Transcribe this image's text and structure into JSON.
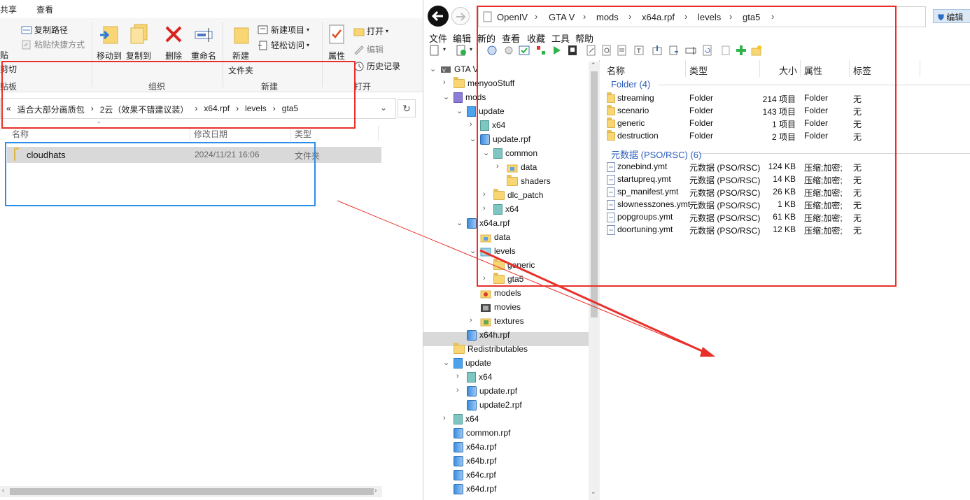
{
  "explorer": {
    "tabs": [
      "共享",
      "查看"
    ],
    "ribbon": {
      "copy_path": "复制路径",
      "paste_shortcut": "粘贴快捷方式",
      "move_to": "移动到",
      "copy_to": "复制到",
      "delete": "删除",
      "rename": "重命名",
      "new_item": "新建项目",
      "easy_access": "轻松访问",
      "new_folder_line1": "新建",
      "new_folder_line2": "文件夹",
      "open": "打开",
      "edit": "编辑",
      "history": "历史记录",
      "properties": "属性",
      "cut": "剪切",
      "paste_partial": "贴",
      "group_clipboard": "贴板",
      "group_organize": "组织",
      "group_new": "新建",
      "group_open": "打开"
    },
    "address": {
      "prefix": "«",
      "crumbs": [
        "适合大部分画质包",
        "2云（效果不错建议装）",
        "x64.rpf",
        "levels",
        "gta5"
      ]
    },
    "columns": [
      "名称",
      "修改日期",
      "类型"
    ],
    "files": [
      {
        "name": "cloudhats",
        "date": "2024/11/21 16:06",
        "type": "文件夹"
      }
    ]
  },
  "openiv": {
    "breadcrumb": [
      "OpenIV",
      "GTA V",
      "mods",
      "x64a.rpf",
      "levels",
      "gta5"
    ],
    "edit_mode": "编辑",
    "menu": [
      "文件",
      "编辑",
      "新的",
      "查看",
      "收藏",
      "工具",
      "帮助"
    ],
    "tree": [
      {
        "label": "GTA V",
        "depth": 0,
        "chev": "v",
        "icon": "gta"
      },
      {
        "label": "menyooStuff",
        "depth": 1,
        "chev": ">",
        "icon": "folder"
      },
      {
        "label": "mods",
        "depth": 1,
        "chev": "v",
        "icon": "purple"
      },
      {
        "label": "update",
        "depth": 2,
        "chev": "v",
        "icon": "blue"
      },
      {
        "label": "x64",
        "depth": 3,
        "chev": ">",
        "icon": "teal"
      },
      {
        "label": "update.rpf",
        "depth": 3,
        "chev": "v",
        "icon": "rpf"
      },
      {
        "label": "common",
        "depth": 4,
        "chev": "v",
        "icon": "teal"
      },
      {
        "label": "data",
        "depth": 5,
        "chev": ">",
        "icon": "folderdata"
      },
      {
        "label": "shaders",
        "depth": 5,
        "chev": "",
        "icon": "folder"
      },
      {
        "label": "dlc_patch",
        "depth": 4,
        "chev": ">",
        "icon": "folder"
      },
      {
        "label": "x64",
        "depth": 4,
        "chev": ">",
        "icon": "teal"
      },
      {
        "label": "x64a.rpf",
        "depth": 2,
        "chev": "v",
        "icon": "rpf"
      },
      {
        "label": "data",
        "depth": 3,
        "chev": "",
        "icon": "folderdata"
      },
      {
        "label": "levels",
        "depth": 3,
        "chev": "v",
        "icon": "levels"
      },
      {
        "label": "generic",
        "depth": 4,
        "chev": "",
        "icon": "folder"
      },
      {
        "label": "gta5",
        "depth": 4,
        "chev": ">",
        "icon": "folder"
      },
      {
        "label": "models",
        "depth": 3,
        "chev": "",
        "icon": "models"
      },
      {
        "label": "movies",
        "depth": 3,
        "chev": "",
        "icon": "movies"
      },
      {
        "label": "textures",
        "depth": 3,
        "chev": ">",
        "icon": "textures"
      },
      {
        "label": "x64h.rpf",
        "depth": 2,
        "chev": "",
        "icon": "rpf"
      },
      {
        "label": "Redistributables",
        "depth": 1,
        "chev": "",
        "icon": "folder"
      },
      {
        "label": "update",
        "depth": 1,
        "chev": "v",
        "icon": "blue"
      },
      {
        "label": "x64",
        "depth": 2,
        "chev": ">",
        "icon": "teal"
      },
      {
        "label": "update.rpf",
        "depth": 2,
        "chev": ">",
        "icon": "rpf"
      },
      {
        "label": "update2.rpf",
        "depth": 2,
        "chev": "",
        "icon": "rpf"
      },
      {
        "label": "x64",
        "depth": 1,
        "chev": ">",
        "icon": "teal"
      },
      {
        "label": "common.rpf",
        "depth": 1,
        "chev": "",
        "icon": "rpf"
      },
      {
        "label": "x64a.rpf",
        "depth": 1,
        "chev": "",
        "icon": "rpf"
      },
      {
        "label": "x64b.rpf",
        "depth": 1,
        "chev": "",
        "icon": "rpf"
      },
      {
        "label": "x64c.rpf",
        "depth": 1,
        "chev": "",
        "icon": "rpf"
      },
      {
        "label": "x64d.rpf",
        "depth": 1,
        "chev": "",
        "icon": "rpf"
      }
    ],
    "columns": [
      "名称",
      "类型",
      "大小",
      "属性",
      "标签"
    ],
    "group_folder": "Folder (4)",
    "folders": [
      {
        "name": "streaming",
        "type": "Folder",
        "size": "214 项目",
        "attr": "Folder",
        "tag": "无"
      },
      {
        "name": "scenario",
        "type": "Folder",
        "size": "143 项目",
        "attr": "Folder",
        "tag": "无"
      },
      {
        "name": "generic",
        "type": "Folder",
        "size": "1 项目",
        "attr": "Folder",
        "tag": "无"
      },
      {
        "name": "destruction",
        "type": "Folder",
        "size": "2 项目",
        "attr": "Folder",
        "tag": "无"
      }
    ],
    "group_meta": "元数据 (PSO/RSC) (6)",
    "meta": [
      {
        "name": "zonebind.ymt",
        "type": "元数据 (PSO/RSC)",
        "size": "124 KB",
        "attr": "压缩;加密;",
        "tag": "无"
      },
      {
        "name": "startupreq.ymt",
        "type": "元数据 (PSO/RSC)",
        "size": "14 KB",
        "attr": "压缩;加密;",
        "tag": "无"
      },
      {
        "name": "sp_manifest.ymt",
        "type": "元数据 (PSO/RSC)",
        "size": "26 KB",
        "attr": "压缩;加密;",
        "tag": "无"
      },
      {
        "name": "slownesszones.ymt",
        "type": "元数据 (PSO/RSC)",
        "size": "1 KB",
        "attr": "压缩;加密;",
        "tag": "无"
      },
      {
        "name": "popgroups.ymt",
        "type": "元数据 (PSO/RSC)",
        "size": "61 KB",
        "attr": "压缩;加密;",
        "tag": "无"
      },
      {
        "name": "doortuning.ymt",
        "type": "元数据 (PSO/RSC)",
        "size": "12 KB",
        "attr": "压缩;加密;",
        "tag": "无"
      }
    ]
  },
  "colors": {
    "annotation_red": "#e8302a",
    "annotation_blue": "#2a8fe8",
    "group_blue": "#2a5dbb",
    "selection_gray": "#d9d9d9"
  }
}
